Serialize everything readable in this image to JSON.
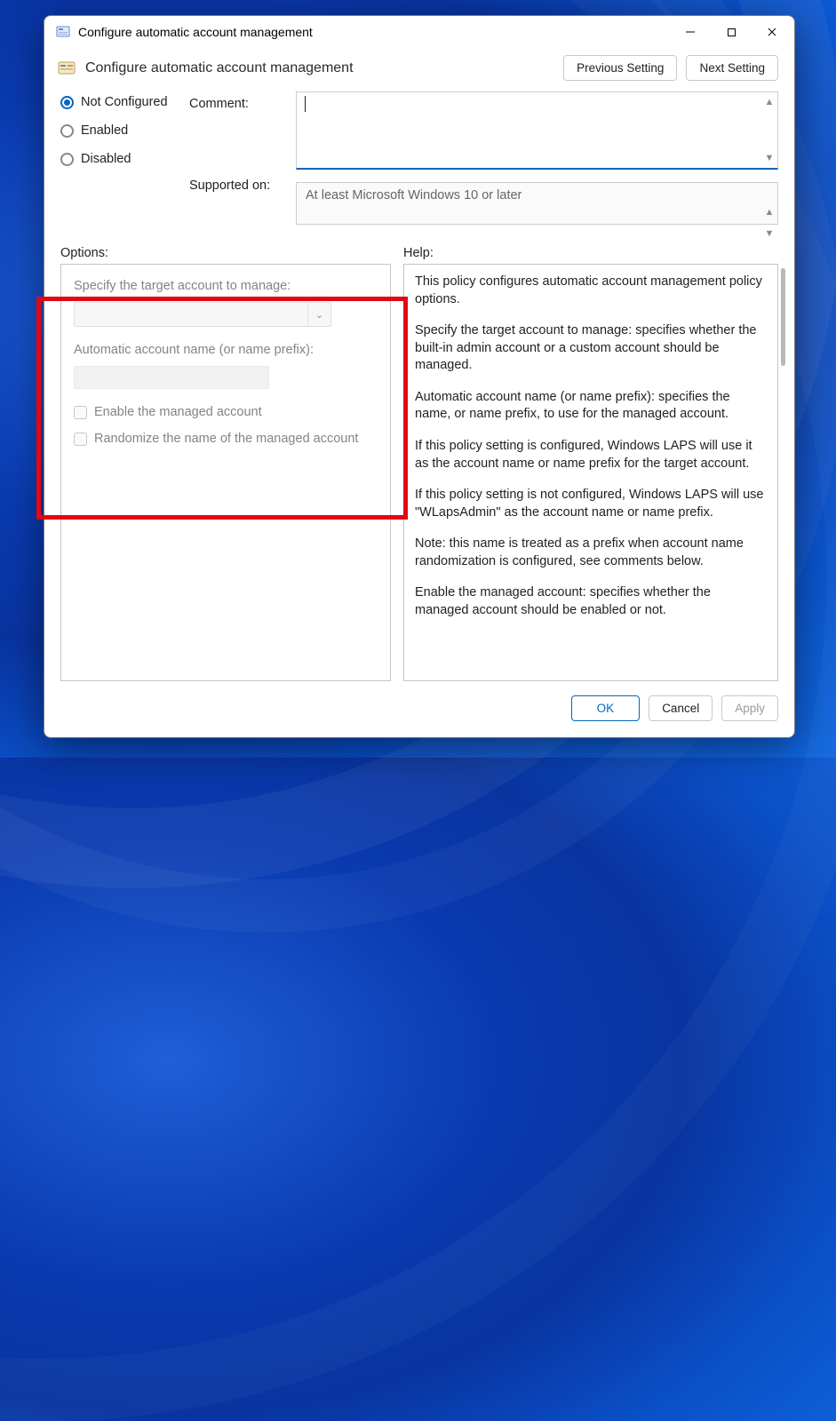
{
  "window": {
    "title": "Configure automatic account management",
    "subtitle": "Configure automatic account management"
  },
  "nav": {
    "prev": "Previous Setting",
    "next": "Next Setting"
  },
  "state": {
    "not_configured": "Not Configured",
    "enabled": "Enabled",
    "disabled": "Disabled",
    "selected": "not_configured"
  },
  "labels": {
    "comment": "Comment:",
    "supported": "Supported on:",
    "options": "Options:",
    "help": "Help:"
  },
  "supported_text": "At least Microsoft Windows 10 or later",
  "options": {
    "target_label": "Specify the target account to manage:",
    "name_label": "Automatic account name (or name prefix):",
    "enable_chk": "Enable the managed account",
    "randomize_chk": "Randomize the name of the managed account"
  },
  "help": {
    "p1": "This policy configures automatic account management policy options.",
    "p2": "Specify the target account to manage: specifies whether the built-in admin account or a custom account should be managed.",
    "p3": "Automatic account name (or name prefix): specifies the name, or name prefix, to use for the managed account.",
    "p4": "If this policy setting is configured, Windows LAPS will use it as the account name or name prefix for the target account.",
    "p5": "If this policy setting is not configured, Windows LAPS will use \"WLapsAdmin\" as the account name or name prefix.",
    "p6": "Note: this name is treated as a prefix when account name randomization is configured, see comments below.",
    "p7": "Enable the managed account: specifies whether the managed account should be enabled or not."
  },
  "footer": {
    "ok": "OK",
    "cancel": "Cancel",
    "apply": "Apply"
  }
}
